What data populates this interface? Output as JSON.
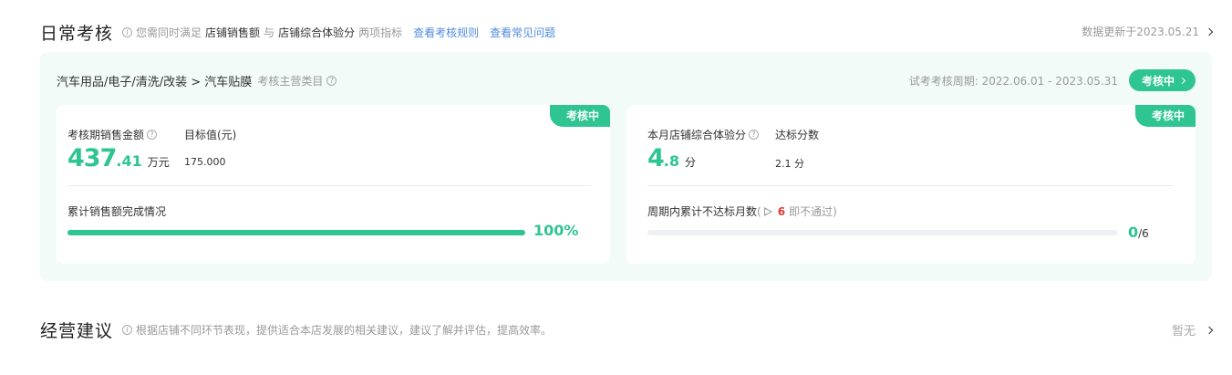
{
  "daily": {
    "title": "日常考核",
    "hint_prefix": "您需同时满足",
    "metric_a": "店铺销售额",
    "conj": "与",
    "metric_b": "店铺综合体验分",
    "hint_suffix": "两项指标",
    "link_rules": "查看考核规则",
    "link_faq": "查看常见问题",
    "updated": "数据更新于2023.05.21"
  },
  "panel": {
    "category": "汽车用品/电子/清洗/改装 > 汽车贴膜",
    "category_hint": "考核主营类目",
    "period": "试考考核周期: 2022.06.01 - 2023.05.31",
    "status": "考核中"
  },
  "sales_card": {
    "badge": "考核中",
    "label": "考核期销售金额",
    "value_int": "437",
    "value_dec": ".41",
    "unit": "万元",
    "target_label": "目标值(元)",
    "target_value": "175.000",
    "progress_label": "累计销售额完成情况",
    "progress_percent": 100,
    "progress_text": "100%"
  },
  "score_card": {
    "badge": "考核中",
    "label": "本月店铺综合体验分",
    "value_int": "4",
    "value_dec": ".8",
    "unit": "分",
    "target_label": "达标分数",
    "target_value": "2.1 分",
    "sub_label": "周期内累计不达标月数",
    "sub_open": "(",
    "sub_red": "6",
    "sub_close": "即不通过)",
    "progress_percent": 0,
    "count_num": "0",
    "count_den": "/6"
  },
  "advice": {
    "title": "经营建议",
    "hint": "根据店铺不同环节表现，提供适合本店发展的相关建议，建议了解并评估，提高效率。",
    "right": "暂无"
  },
  "colors": {
    "accent": "#2ec592",
    "link": "#4f8be0",
    "warn": "#e3382e",
    "panel_bg": "#f2fbf8"
  }
}
